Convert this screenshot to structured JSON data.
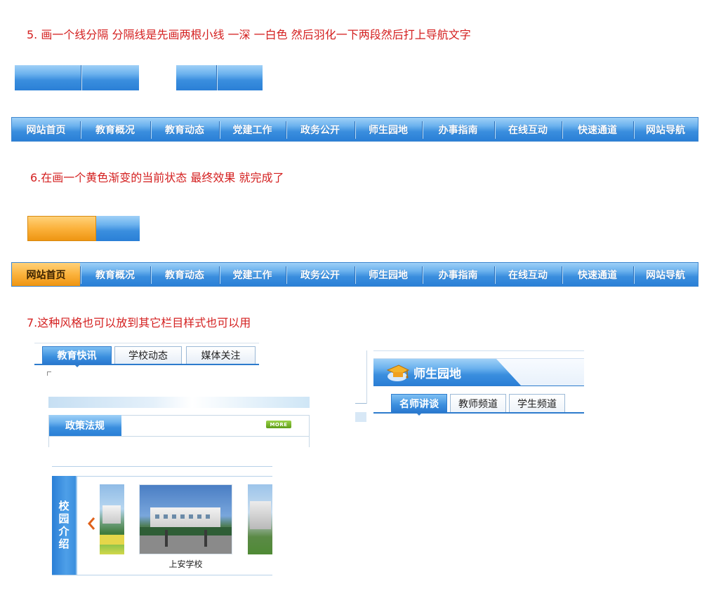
{
  "steps": {
    "step5": "5. 画一个线分隔 分隔线是先画两根小线 一深 一白色  然后羽化一下两段然后打上导航文字",
    "step6": "6.在画一个黄色渐变的当前状态 最终效果 就完成了",
    "step7": "7.这种风格也可以放到其它栏目样式也可以用"
  },
  "nav": {
    "items": [
      "网站首页",
      "教育概况",
      "教育动态",
      "党建工作",
      "政务公开",
      "师生园地",
      "办事指南",
      "在线互动",
      "快速通道",
      "网站导航"
    ]
  },
  "tabs1": {
    "items": [
      "教育快讯",
      "学校动态",
      "媒体关注"
    ]
  },
  "policy": {
    "title": "政策法规",
    "more": "MORE"
  },
  "garden": {
    "title": "师生园地",
    "tabs": [
      "名师讲谈",
      "教师频道",
      "学生频道"
    ]
  },
  "campus": {
    "side_title": "校园介绍",
    "caption": "上安学校",
    "arrow_icon": "arrow-left-icon"
  },
  "colors": {
    "note": "#d42020",
    "nav_blue": "#3a8ede",
    "active_orange": "#fbb23c"
  }
}
